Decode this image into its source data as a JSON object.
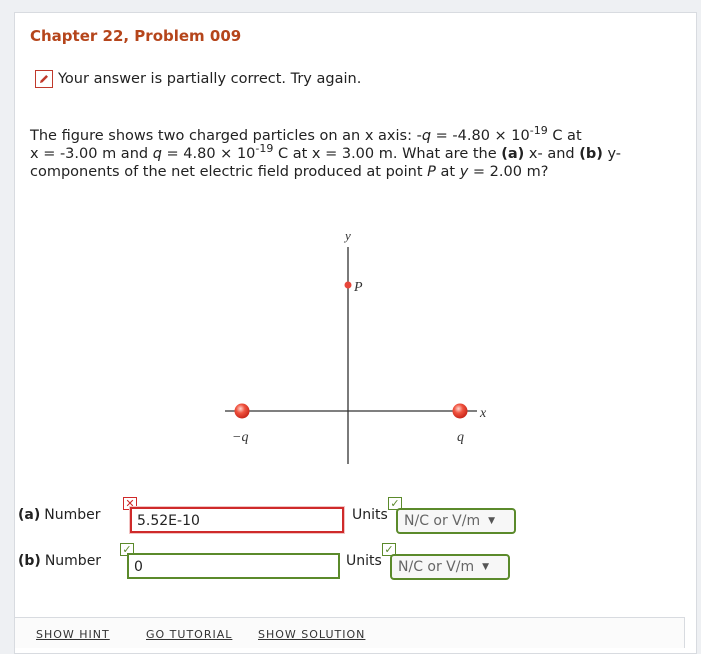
{
  "header": {
    "title": "Chapter 22, Problem 009"
  },
  "status": {
    "message": "Your answer is partially correct.  Try again."
  },
  "problem": {
    "line1_pre": "The figure shows two charged particles on an x axis: -",
    "line1_q": "q",
    "line1_mid": " = -4.80 × 10",
    "line1_exp": "-19",
    "line1_post": " C at",
    "line2_a": "x = -3.00 m and ",
    "line2_q": "q",
    "line2_b": " = 4.80 × 10",
    "line2_exp": "-19",
    "line2_c": " C at x = 3.00 m. What are the ",
    "part_a": "(a)",
    "line2_d": " x- and ",
    "part_b": "(b)",
    "line2_e": " y-",
    "line3_a": "components of the net electric field produced at point ",
    "line3_p": "P",
    "line3_b": " at ",
    "line3_y": "y",
    "line3_c": " = 2.00 m?"
  },
  "figure": {
    "y_axis_label": "y",
    "x_axis_label": "x",
    "point_label": "P",
    "neg_charge_label": "−q",
    "pos_charge_label": "q"
  },
  "answers": {
    "a": {
      "letter": "(a)",
      "label": "Number",
      "value": "5.52E-10",
      "correct": false,
      "units_label": "Units",
      "units_value": "N/C or V/m",
      "units_correct": true
    },
    "b": {
      "letter": "(b)",
      "label": "Number",
      "value": "0",
      "correct": true,
      "units_label": "Units",
      "units_value": "N/C or V/m",
      "units_correct": true
    }
  },
  "footer": {
    "show_hint": "SHOW HINT",
    "go_tutorial": "GO TUTORIAL",
    "show_solution": "SHOW SOLUTION"
  },
  "colors": {
    "title": "#b5451b",
    "wrong": "#cf2a2a",
    "correct": "#5b8a2b",
    "charge": "#e8463a"
  }
}
